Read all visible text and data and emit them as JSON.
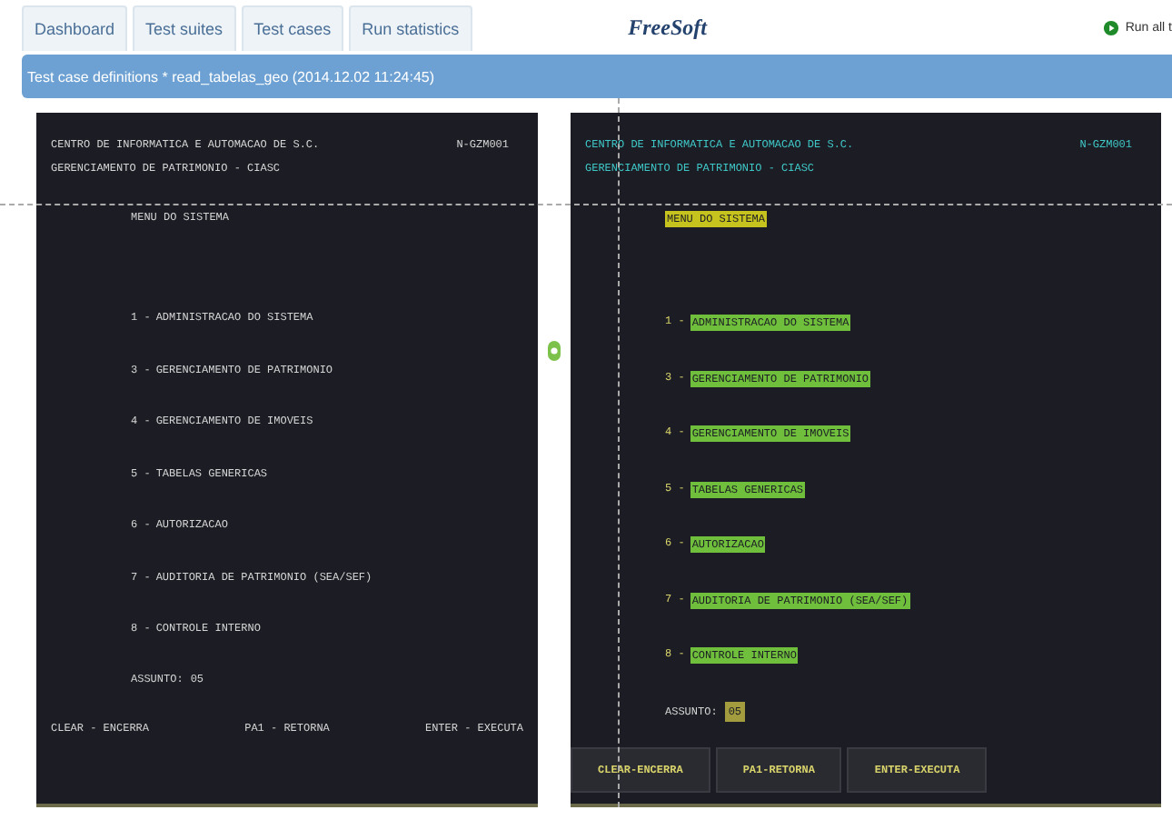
{
  "tabs": [
    {
      "label": "Dashboard",
      "selected": false
    },
    {
      "label": "Test suites",
      "selected": false
    },
    {
      "label": "Test cases",
      "selected": false
    },
    {
      "label": "Run statistics",
      "selected": false
    }
  ],
  "logo": "FreeSoft",
  "run_button": "Run all t",
  "title_bar": "Test case definitions * read_tabelas_geo (2014.12.02 11:24:45)",
  "screens": [
    {
      "kind": "plain",
      "header": [
        "CENTRO DE INFORMATICA E AUTOMACAO DE S.C.",
        "GERENCIAMENTO DE PATRIMONIO - CIASC"
      ],
      "code": "N-GZM001",
      "menu_title": "MENU DO SISTEMA",
      "items": [
        {
          "number": "1 -",
          "text": "ADMINISTRACAO DO SISTEMA"
        },
        {
          "number": "3 -",
          "text": "GERENCIAMENTO DE PATRIMONIO"
        },
        {
          "number": "4 -",
          "text": "GERENCIAMENTO DE IMOVEIS"
        },
        {
          "number": "5 -",
          "text": "TABELAS GENERICAS"
        },
        {
          "number": "6 -",
          "text": "AUTORIZACAO"
        },
        {
          "number": "7 -",
          "text": "AUDITORIA DE PATRIMONIO (SEA/SEF)"
        },
        {
          "number": "8 -",
          "text": "CONTROLE INTERNO"
        }
      ],
      "prompt_label": "ASSUNTO:",
      "prompt_value": "05",
      "keys": [
        "CLEAR - ENCERRA",
        "PA1 - RETORNA",
        "ENTER - EXECUTA"
      ]
    },
    {
      "kind": "styled",
      "header": [
        "CENTRO DE INFORMATICA E AUTOMACAO DE S.C.",
        "GERENCIAMENTO DE PATRIMONIO - CIASC"
      ],
      "code": "N-GZM001",
      "menu_title": "MENU DO SISTEMA",
      "items": [
        {
          "number": "1 -",
          "text": "ADMINISTRACAO DO SISTEMA"
        },
        {
          "number": "3 -",
          "text": "GERENCIAMENTO DE PATRIMONIO"
        },
        {
          "number": "4 -",
          "text": "GERENCIAMENTO DE IMOVEIS"
        },
        {
          "number": "5 -",
          "text": "TABELAS GENERICAS"
        },
        {
          "number": "6 -",
          "text": "AUTORIZACAO"
        },
        {
          "number": "7 -",
          "text": "AUDITORIA DE PATRIMONIO (SEA/SEF)"
        },
        {
          "number": "8 -",
          "text": "CONTROLE INTERNO"
        }
      ],
      "prompt_label": "ASSUNTO:",
      "prompt_value": "05",
      "keys": [
        "CLEAR-ENCERRA",
        "PA1-RETORNA",
        "ENTER-EXECUTA"
      ]
    }
  ]
}
